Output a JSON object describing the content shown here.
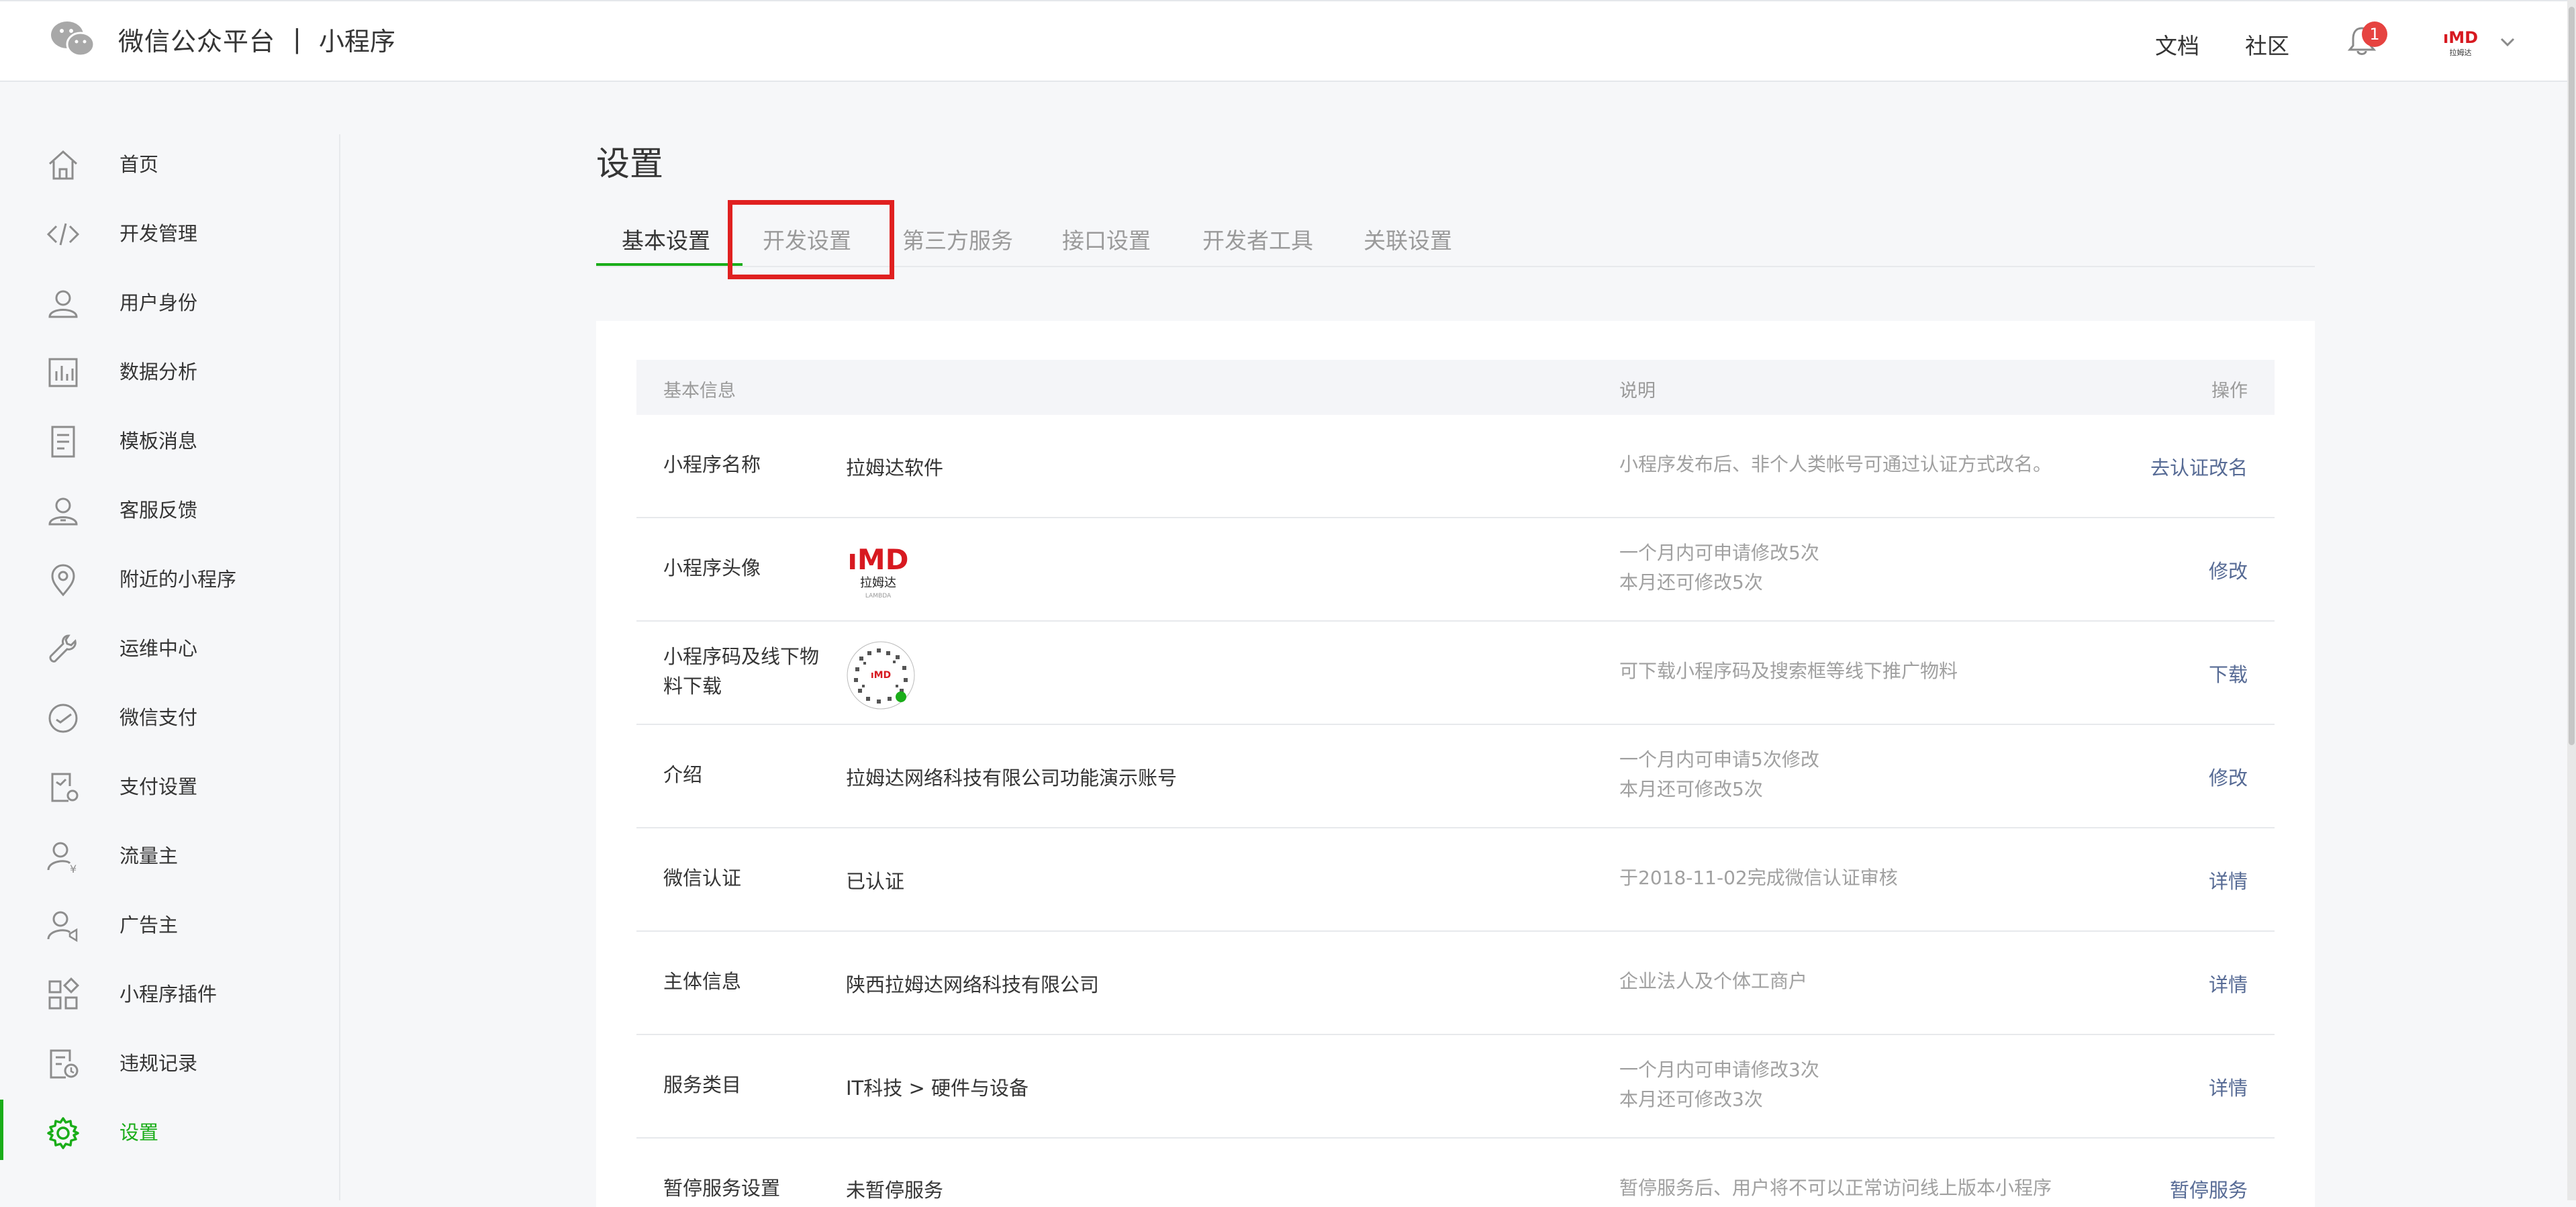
{
  "header": {
    "brand_title": "微信公众平台",
    "separator": "|",
    "brand_sub": "小程序",
    "docs": "文档",
    "community": "社区",
    "notification_count": "1",
    "accent_color": "#1aad19"
  },
  "sidebar": {
    "items": [
      {
        "label": "首页",
        "icon": "home-icon"
      },
      {
        "label": "开发管理",
        "icon": "code-icon"
      },
      {
        "label": "用户身份",
        "icon": "user-icon"
      },
      {
        "label": "数据分析",
        "icon": "bar-chart-icon"
      },
      {
        "label": "模板消息",
        "icon": "document-icon"
      },
      {
        "label": "客服反馈",
        "icon": "customer-service-icon"
      },
      {
        "label": "附近的小程序",
        "icon": "location-pin-icon"
      },
      {
        "label": "运维中心",
        "icon": "wrench-icon"
      },
      {
        "label": "微信支付",
        "icon": "payment-icon"
      },
      {
        "label": "支付设置",
        "icon": "payment-settings-icon"
      },
      {
        "label": "流量主",
        "icon": "traffic-owner-icon"
      },
      {
        "label": "广告主",
        "icon": "advertiser-icon"
      },
      {
        "label": "小程序插件",
        "icon": "plugin-grid-icon"
      },
      {
        "label": "违规记录",
        "icon": "violation-record-icon"
      },
      {
        "label": "设置",
        "icon": "gear-icon",
        "active": true
      }
    ]
  },
  "main": {
    "title": "设置",
    "tabs": [
      {
        "label": "基本设置",
        "active": true
      },
      {
        "label": "开发设置"
      },
      {
        "label": "第三方服务"
      },
      {
        "label": "接口设置"
      },
      {
        "label": "开发者工具"
      },
      {
        "label": "关联设置"
      }
    ],
    "table": {
      "headers": {
        "info": "基本信息",
        "desc": "说明",
        "op": "操作"
      },
      "rows": [
        {
          "name": "小程序名称",
          "value": "拉姆达软件",
          "desc": [
            "小程序发布后、非个人类帐号可通过认证方式改名。"
          ],
          "op": "去认证改名"
        },
        {
          "name": "小程序头像",
          "value": "",
          "image": "lmd-logo",
          "desc": [
            "一个月内可申请修改5次",
            "本月还可修改5次"
          ],
          "op": "修改"
        },
        {
          "name": "小程序码及线下物料下载",
          "value": "",
          "image": "qr-code",
          "desc": [
            "可下载小程序码及搜索框等线下推广物料"
          ],
          "op": "下载"
        },
        {
          "name": "介绍",
          "value": "拉姆达网络科技有限公司功能演示账号",
          "desc": [
            "一个月内可申请5次修改",
            "本月还可修改5次"
          ],
          "op": "修改"
        },
        {
          "name": "微信认证",
          "value": "已认证",
          "desc": [
            "于2018-11-02完成微信认证审核"
          ],
          "op": "详情"
        },
        {
          "name": "主体信息",
          "value": "陕西拉姆达网络科技有限公司",
          "desc": [
            "企业法人及个体工商户"
          ],
          "op": "详情"
        },
        {
          "name": "服务类目",
          "value": "IT科技 > 硬件与设备",
          "desc": [
            "一个月内可申请修改3次",
            "本月还可修改3次"
          ],
          "op": "详情"
        },
        {
          "name": "暂停服务设置",
          "value": "未暂停服务",
          "desc": [
            "暂停服务后、用户将不可以正常访问线上版本小程序"
          ],
          "op": "暂停服务"
        }
      ]
    }
  },
  "logo": {
    "text": "ıMD",
    "sub": "拉姆达",
    "tiny": "LAMBDA"
  }
}
